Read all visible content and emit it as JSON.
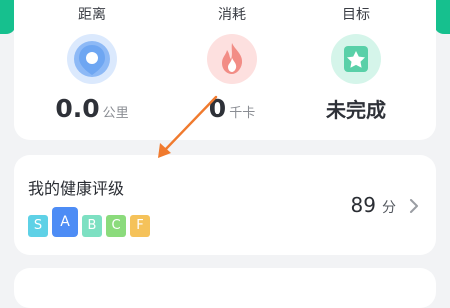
{
  "stats": [
    {
      "label": "距离",
      "value": "0.0",
      "unit": "公里",
      "icon": "location-pin-icon"
    },
    {
      "label": "消耗",
      "value": "0",
      "unit": "千卡",
      "icon": "flame-icon"
    },
    {
      "label": "目标",
      "value": "未完成",
      "unit": "",
      "icon": "star-icon"
    }
  ],
  "health_rating": {
    "title": "我的健康评级",
    "grades": [
      "S",
      "A",
      "B",
      "C",
      "F"
    ],
    "active_grade": "A",
    "score": "89",
    "score_unit": "分"
  },
  "colors": {
    "accent": "#16c08e",
    "grade_S": "#5ed1e6",
    "grade_A": "#4d8cf5",
    "grade_B": "#7de0c2",
    "grade_C": "#8bdb7c",
    "grade_F": "#f5c25a",
    "annotation_arrow": "#f07a2e"
  }
}
